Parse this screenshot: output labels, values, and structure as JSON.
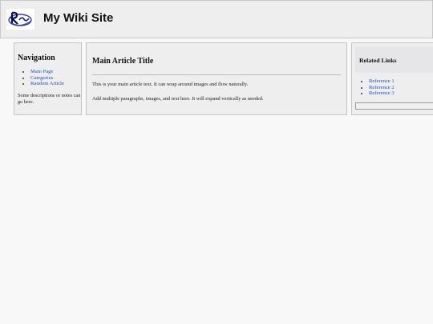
{
  "header": {
    "logo_icon": "wiki-logo-icon",
    "site_title": "My Wiki Site"
  },
  "sidebar": {
    "title": "Navigation",
    "links": [
      "Main Page",
      "Categories",
      "Random Article"
    ],
    "note": "Some descriptions or notes can go here."
  },
  "article": {
    "title": "Main Article Title",
    "paragraphs": [
      "This is your main article text. It can wrap around images and flow naturally.",
      "Add multiple paragraphs, images, and text here. It will expand vertically as needed."
    ]
  },
  "related": {
    "title": "Related Links",
    "links": [
      "Reference 1",
      "Reference 2",
      "Reference 3"
    ]
  },
  "colors": {
    "link": "#1f4fbf",
    "panel_bg": "#eeeeef",
    "page_bg": "#f8f8f8"
  }
}
